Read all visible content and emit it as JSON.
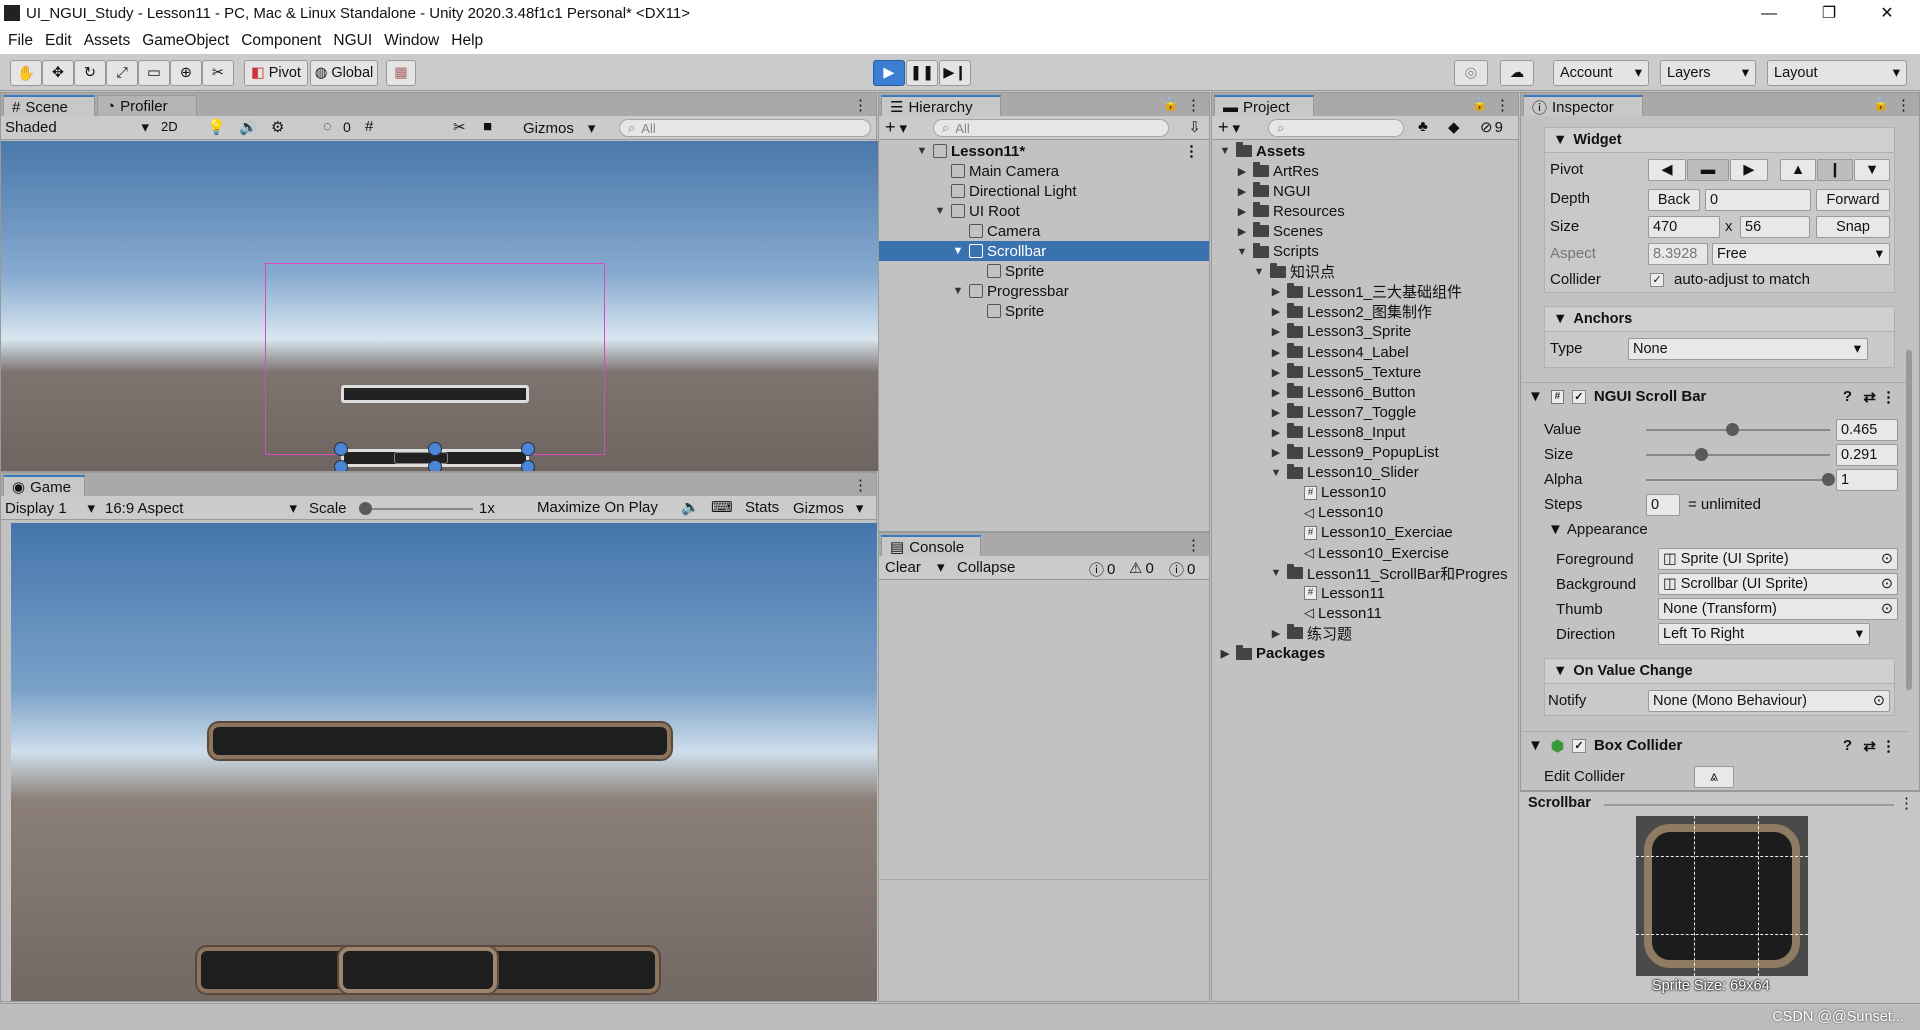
{
  "window": {
    "title": "UI_NGUI_Study - Lesson11 - PC, Mac & Linux Standalone - Unity 2020.3.48f1c1 Personal* <DX11>",
    "minimize": "—",
    "maximize": "❐",
    "close": "✕"
  },
  "menu": [
    "File",
    "Edit",
    "Assets",
    "GameObject",
    "Component",
    "NGUI",
    "Window",
    "Help"
  ],
  "toolbar": {
    "pivot": "Pivot",
    "global": "Global",
    "account": "Account",
    "layers": "Layers",
    "layout": "Layout"
  },
  "scene": {
    "tab": "Scene",
    "profiler_tab": "Profiler",
    "shading": "Shaded",
    "mode2d": "2D",
    "hidden_count": "0",
    "gizmos": "Gizmos",
    "search_placeholder": "All"
  },
  "game": {
    "tab": "Game",
    "display": "Display 1",
    "aspect": "16:9 Aspect",
    "scale_label": "Scale",
    "scale_value": "1x",
    "maximize": "Maximize On Play",
    "stats": "Stats",
    "gizmos": "Gizmos"
  },
  "hierarchy": {
    "tab": "Hierarchy",
    "search_placeholder": "All",
    "items": [
      {
        "label": "Lesson11*",
        "depth": 0,
        "arrow": "▼",
        "bold": true,
        "icon": "unity-scene-icon"
      },
      {
        "label": "Main Camera",
        "depth": 1,
        "arrow": "",
        "icon": "gameobject-icon"
      },
      {
        "label": "Directional Light",
        "depth": 1,
        "arrow": "",
        "icon": "gameobject-icon"
      },
      {
        "label": "UI Root",
        "depth": 1,
        "arrow": "▼",
        "icon": "gameobject-icon"
      },
      {
        "label": "Camera",
        "depth": 2,
        "arrow": "",
        "icon": "gameobject-icon"
      },
      {
        "label": "Scrollbar",
        "depth": 2,
        "arrow": "▼",
        "icon": "gameobject-icon",
        "selected": true
      },
      {
        "label": "Sprite",
        "depth": 3,
        "arrow": "",
        "icon": "gameobject-icon"
      },
      {
        "label": "Progressbar",
        "depth": 2,
        "arrow": "▼",
        "icon": "gameobject-icon"
      },
      {
        "label": "Sprite",
        "depth": 3,
        "arrow": "",
        "icon": "gameobject-icon"
      }
    ]
  },
  "console": {
    "tab": "Console",
    "clear": "Clear",
    "collapse": "Collapse",
    "info_count": "0",
    "warn_count": "0",
    "error_count": "0"
  },
  "project": {
    "tab": "Project",
    "filter_count": "9",
    "items": [
      {
        "label": "Assets",
        "depth": 0,
        "arrow": "▼",
        "bold": true,
        "type": "folder"
      },
      {
        "label": "ArtRes",
        "depth": 1,
        "arrow": "▶",
        "type": "folder"
      },
      {
        "label": "NGUI",
        "depth": 1,
        "arrow": "▶",
        "type": "folder"
      },
      {
        "label": "Resources",
        "depth": 1,
        "arrow": "▶",
        "type": "folder"
      },
      {
        "label": "Scenes",
        "depth": 1,
        "arrow": "▶",
        "type": "folder"
      },
      {
        "label": "Scripts",
        "depth": 1,
        "arrow": "▼",
        "type": "folder"
      },
      {
        "label": "知识点",
        "depth": 2,
        "arrow": "▼",
        "type": "folder"
      },
      {
        "label": "Lesson1_三大基础组件",
        "depth": 3,
        "arrow": "▶",
        "type": "folder"
      },
      {
        "label": "Lesson2_图集制作",
        "depth": 3,
        "arrow": "▶",
        "type": "folder"
      },
      {
        "label": "Lesson3_Sprite",
        "depth": 3,
        "arrow": "▶",
        "type": "folder"
      },
      {
        "label": "Lesson4_Label",
        "depth": 3,
        "arrow": "▶",
        "type": "folder"
      },
      {
        "label": "Lesson5_Texture",
        "depth": 3,
        "arrow": "▶",
        "type": "folder"
      },
      {
        "label": "Lesson6_Button",
        "depth": 3,
        "arrow": "▶",
        "type": "folder"
      },
      {
        "label": "Lesson7_Toggle",
        "depth": 3,
        "arrow": "▶",
        "type": "folder"
      },
      {
        "label": "Lesson8_Input",
        "depth": 3,
        "arrow": "▶",
        "type": "folder"
      },
      {
        "label": "Lesson9_PopupList",
        "depth": 3,
        "arrow": "▶",
        "type": "folder"
      },
      {
        "label": "Lesson10_Slider",
        "depth": 3,
        "arrow": "▼",
        "type": "folder"
      },
      {
        "label": "Lesson10",
        "depth": 4,
        "arrow": "",
        "type": "script"
      },
      {
        "label": "Lesson10",
        "depth": 4,
        "arrow": "",
        "type": "scene"
      },
      {
        "label": "Lesson10_Exerciae",
        "depth": 4,
        "arrow": "",
        "type": "script"
      },
      {
        "label": "Lesson10_Exercise",
        "depth": 4,
        "arrow": "",
        "type": "scene"
      },
      {
        "label": "Lesson11_ScrollBar和Progres",
        "depth": 3,
        "arrow": "▼",
        "type": "folder"
      },
      {
        "label": "Lesson11",
        "depth": 4,
        "arrow": "",
        "type": "script"
      },
      {
        "label": "Lesson11",
        "depth": 4,
        "arrow": "",
        "type": "scene"
      },
      {
        "label": "练习题",
        "depth": 3,
        "arrow": "▶",
        "type": "folder"
      },
      {
        "label": "Packages",
        "depth": 0,
        "arrow": "▶",
        "bold": true,
        "type": "folder"
      }
    ]
  },
  "inspector": {
    "tab": "Inspector",
    "widget": {
      "header": "Widget",
      "pivot_label": "Pivot",
      "depth_label": "Depth",
      "depth_back": "Back",
      "depth_value": "0",
      "depth_forward": "Forward",
      "size_label": "Size",
      "size_w": "470",
      "size_x": "x",
      "size_h": "56",
      "snap": "Snap",
      "aspect_label": "Aspect",
      "aspect_value": "8.3928",
      "aspect_mode": "Free",
      "collider_label": "Collider",
      "collider_text": "auto-adjust to match"
    },
    "anchors": {
      "header": "Anchors",
      "type_label": "Type",
      "type_value": "None"
    },
    "scrollbar": {
      "header": "NGUI Scroll Bar",
      "value_label": "Value",
      "value": "0.465",
      "size_label": "Size",
      "size": "0.291",
      "alpha_label": "Alpha",
      "alpha": "1",
      "steps_label": "Steps",
      "steps": "0",
      "steps_note": "= unlimited",
      "appearance": "Appearance",
      "foreground_label": "Foreground",
      "foreground": "Sprite (UI Sprite)",
      "background_label": "Background",
      "background": "Scrollbar (UI Sprite)",
      "thumb_label": "Thumb",
      "thumb": "None (Transform)",
      "direction_label": "Direction",
      "direction": "Left To Right",
      "onchange": "On Value Change",
      "notify_label": "Notify",
      "notify": "None (Mono Behaviour)"
    },
    "box_collider": {
      "header": "Box Collider",
      "edit_label": "Edit Collider"
    },
    "preview": {
      "title": "Scrollbar",
      "size_text": "Sprite Size: 69x64"
    }
  },
  "watermark": "CSDN @@Sunset..."
}
